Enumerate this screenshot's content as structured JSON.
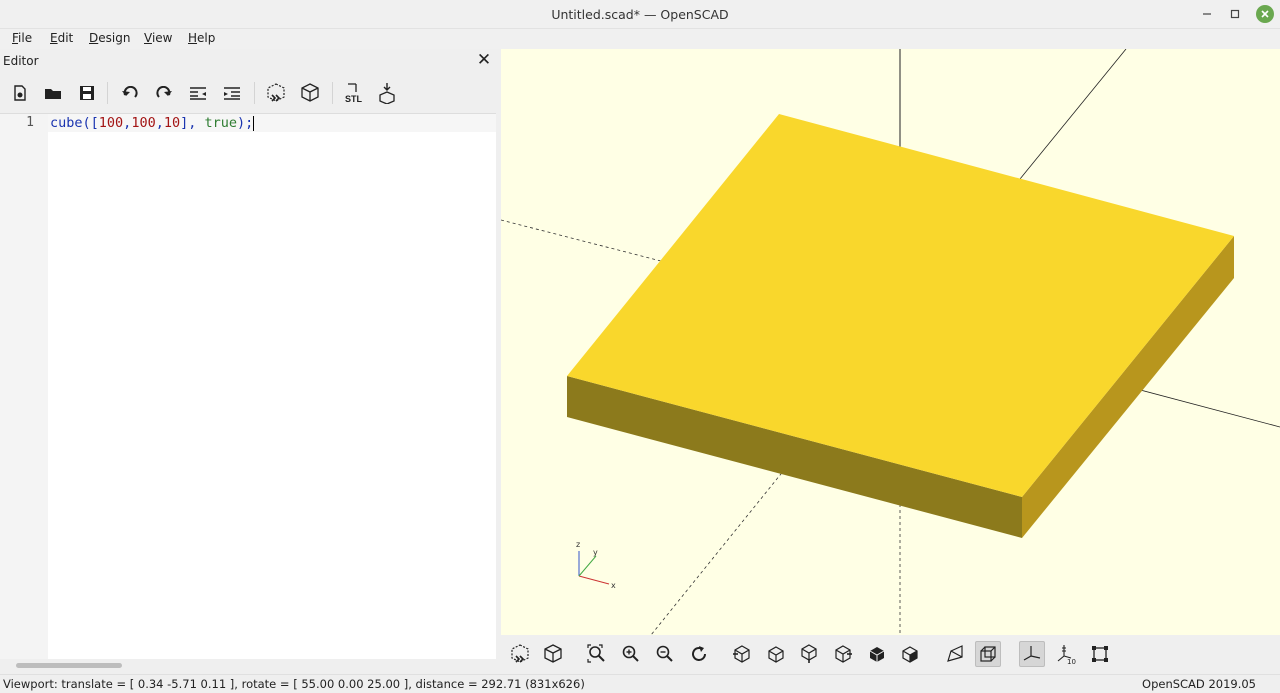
{
  "window": {
    "title": "Untitled.scad* — OpenSCAD"
  },
  "menu": [
    {
      "label": "File",
      "mnemonic": "F",
      "rest": "ile"
    },
    {
      "label": "Edit",
      "mnemonic": "E",
      "rest": "dit"
    },
    {
      "label": "Design",
      "mnemonic": "D",
      "rest": "esign"
    },
    {
      "label": "View",
      "mnemonic": "V",
      "rest": "iew"
    },
    {
      "label": "Help",
      "mnemonic": "H",
      "rest": "elp"
    }
  ],
  "editor": {
    "header": "Editor",
    "close_glyph": "✕",
    "toolbar_icons": [
      "new-file-icon",
      "open-file-icon",
      "save-icon",
      "undo-icon",
      "redo-icon",
      "unindent-icon",
      "indent-icon",
      "preview-icon",
      "render-icon",
      "export-stl-icon",
      "send-to-3d-print-icon"
    ],
    "line_number": "1",
    "code": {
      "fn": "cube",
      "open": "([",
      "n1": "100",
      "c1": ",",
      "n2": "100",
      "c2": ",",
      "n3": "10",
      "close_arr": "], ",
      "bool": "true",
      "end": ");"
    }
  },
  "viewport": {
    "background": "#ffffe5",
    "cube_top_color": "#f9d72c",
    "cube_side_color": "#b8961d",
    "cube_front_color": "#8c7a1c"
  },
  "view_toolbar_icons": [
    "preview-icon",
    "render-icon",
    "view-all-icon",
    "zoom-in-icon",
    "zoom-out-icon",
    "reset-view-icon",
    "view-right-icon",
    "view-top-icon",
    "view-bottom-icon",
    "view-left-icon",
    "view-front-icon",
    "view-back-icon",
    "perspective-icon",
    "orthogonal-icon",
    "show-axes-icon",
    "show-scale-markers-icon",
    "show-edges-icon"
  ],
  "statusbar": {
    "viewport_text": "Viewport: translate = [ 0.34 -5.71 0.11 ], rotate = [ 55.00 0.00 25.00 ], distance = 292.71 (831x626)",
    "version": "OpenSCAD 2019.05"
  }
}
